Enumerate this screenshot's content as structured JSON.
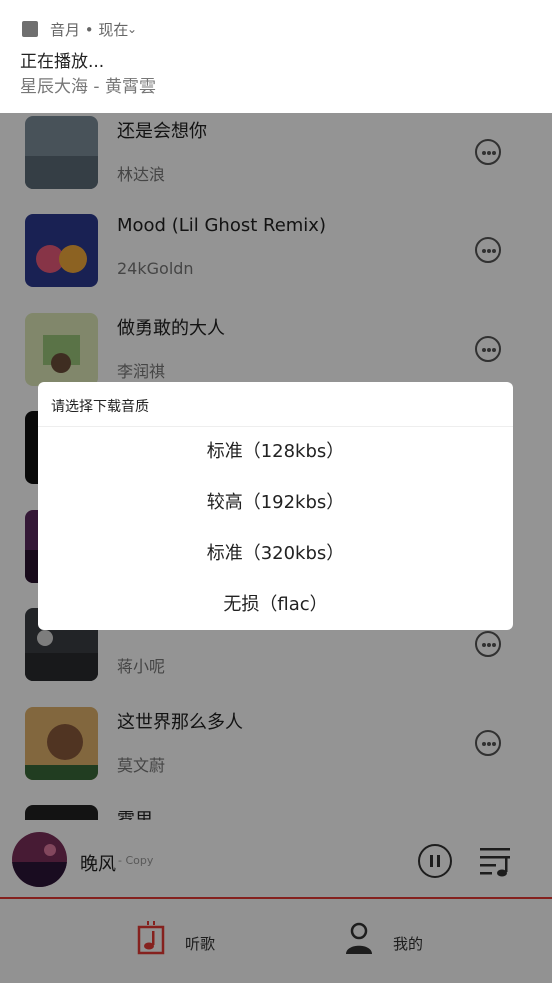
{
  "notification": {
    "app_line": "音月 • 现在",
    "title": "正在播放...",
    "body": "星辰大海 - 黄霄雲"
  },
  "songs": [
    {
      "title": "还是会想你",
      "artist": "林达浪"
    },
    {
      "title": "Mood (Lil Ghost Remix)",
      "artist": "24kGoldn"
    },
    {
      "title": "做勇敢的大人",
      "artist": "李润祺"
    },
    {
      "title": "",
      "artist": ""
    },
    {
      "title": "",
      "artist": ""
    },
    {
      "title": "",
      "artist": "蒋小呢"
    },
    {
      "title": "这世界那么多人",
      "artist": "莫文蔚"
    },
    {
      "title": "雾里",
      "artist": ""
    }
  ],
  "dialog": {
    "title": "请选择下载音质",
    "options": [
      "标准（128kbs）",
      "较高（192kbs）",
      "标准（320kbs）",
      "无损（flac）"
    ]
  },
  "player": {
    "title": "晚风",
    "subtitle": "- Copy"
  },
  "tabs": [
    {
      "label": "听歌",
      "icon": "music-note-icon"
    },
    {
      "label": "我的",
      "icon": "person-icon"
    }
  ],
  "colors": {
    "accent": "#e53935",
    "overlay": "rgba(0,0,0,0.42)"
  }
}
